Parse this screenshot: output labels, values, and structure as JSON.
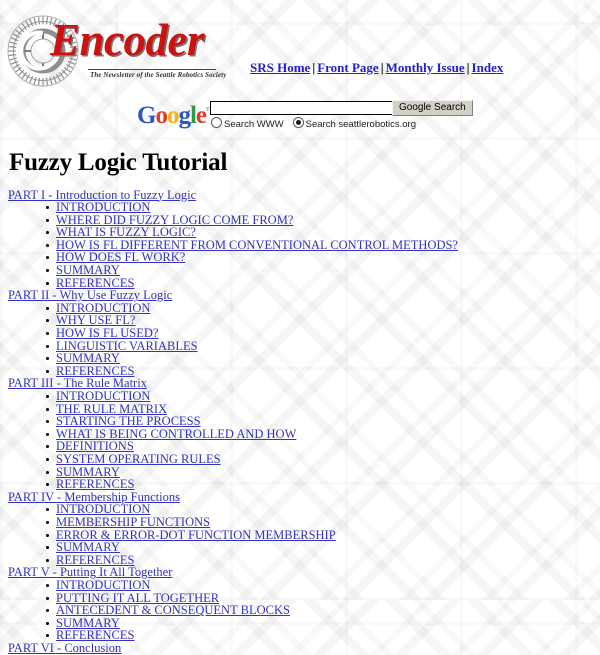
{
  "masthead": {
    "logo": {
      "wordmark": "Encoder",
      "tagline": "The Newsletter of the Seattle Robotics Society",
      "gear_icon": "encoder-wheel-icon",
      "wordmark_color": "#cc1111"
    },
    "nav": {
      "separator": "|",
      "links": [
        {
          "label": "SRS Home"
        },
        {
          "label": "Front Page"
        },
        {
          "label": "Monthly Issue"
        },
        {
          "label": "Index"
        }
      ]
    }
  },
  "search": {
    "brand": {
      "letters": [
        {
          "char": "G",
          "color": "#2a56c6"
        },
        {
          "char": "o",
          "color": "#e03e2d"
        },
        {
          "char": "o",
          "color": "#f2b50f"
        },
        {
          "char": "g",
          "color": "#2a56c6"
        },
        {
          "char": "l",
          "color": "#2d9a47"
        },
        {
          "char": "e",
          "color": "#e03e2d"
        }
      ],
      "trademark": "™"
    },
    "query_value": "",
    "query_placeholder": "",
    "submit_label": "Google Search",
    "scopes": [
      {
        "label": "Search WWW",
        "selected": false
      },
      {
        "label": "Search seattlerobotics.org",
        "selected": true
      }
    ]
  },
  "page": {
    "title": "Fuzzy Logic Tutorial"
  },
  "toc": {
    "parts": [
      {
        "heading": "PART I - Introduction to Fuzzy Logic",
        "items": [
          "INTRODUCTION",
          "WHERE DID FUZZY LOGIC COME FROM?",
          "WHAT IS FUZZY LOGIC?",
          "HOW IS FL DIFFERENT FROM CONVENTIONAL CONTROL METHODS?",
          "HOW DOES FL WORK?",
          "SUMMARY",
          "REFERENCES"
        ]
      },
      {
        "heading": "PART II - Why Use Fuzzy Logic",
        "items": [
          "INTRODUCTION",
          "WHY USE FL?",
          "HOW IS FL USED?",
          "LINGUISTIC VARIABLES",
          "SUMMARY",
          "REFERENCES"
        ]
      },
      {
        "heading": "PART III - The Rule Matrix",
        "items": [
          "INTRODUCTION",
          "THE RULE MATRIX",
          "STARTING THE PROCESS",
          "WHAT IS BEING CONTROLLED AND HOW",
          "DEFINITIONS",
          "SYSTEM OPERATING RULES",
          "SUMMARY",
          "REFERENCES"
        ]
      },
      {
        "heading": "PART IV - Membership Functions",
        "items": [
          "INTRODUCTION",
          "MEMBERSHIP FUNCTIONS",
          "ERROR & ERROR-DOT FUNCTION MEMBERSHIP",
          "SUMMARY",
          "REFERENCES"
        ]
      },
      {
        "heading": "PART V - Putting It All Together",
        "items": [
          "INTRODUCTION",
          "PUTTING IT ALL TOGETHER",
          "ANTECEDENT & CONSEQUENT BLOCKS",
          "SUMMARY",
          "REFERENCES"
        ]
      },
      {
        "heading": "PART VI - Conclusion",
        "items": []
      }
    ]
  },
  "theme": {
    "link_color": "#3333bb",
    "nav_link_color": "#2222cc",
    "background": "#ffffff"
  }
}
